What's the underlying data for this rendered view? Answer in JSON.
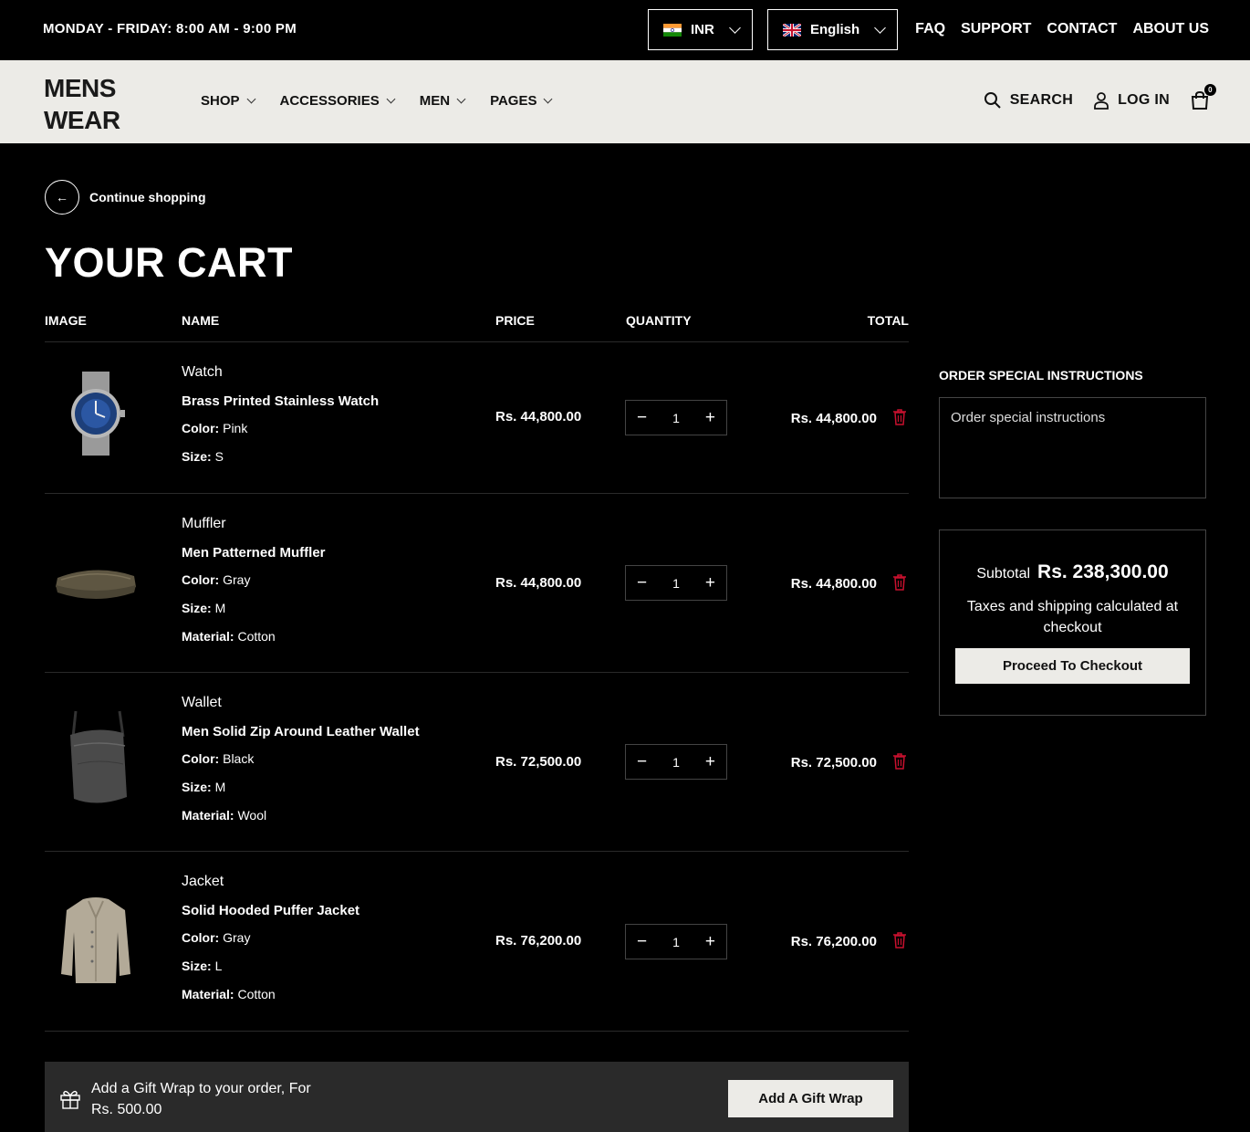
{
  "topbar": {
    "hours": "MONDAY - FRIDAY: 8:00 AM - 9:00 PM",
    "currency": "INR",
    "language": "English",
    "links": [
      "FAQ",
      "SUPPORT",
      "CONTACT",
      "ABOUT US"
    ]
  },
  "header": {
    "logo_line1": "MENS",
    "logo_line2": "WEAR",
    "nav": [
      "SHOP",
      "ACCESSORIES",
      "MEN",
      "PAGES"
    ],
    "search_label": "SEARCH",
    "login_label": "LOG IN",
    "cart_count": "0"
  },
  "cart": {
    "continue_label": "Continue shopping",
    "title": "YOUR CART",
    "columns": {
      "image": "IMAGE",
      "name": "NAME",
      "price": "PRICE",
      "quantity": "QUANTITY",
      "total": "TOTAL"
    },
    "items": [
      {
        "category": "Watch",
        "name": "Brass Printed Stainless Watch",
        "color_label": "Color:",
        "color": "Pink",
        "size_label": "Size:",
        "size": "S",
        "material_label": "",
        "material": "",
        "price": "Rs. 44,800.00",
        "qty": "1",
        "total": "Rs. 44,800.00"
      },
      {
        "category": "Muffler",
        "name": "Men Patterned Muffler",
        "color_label": "Color:",
        "color": "Gray",
        "size_label": "Size:",
        "size": "M",
        "material_label": "Material:",
        "material": "Cotton",
        "price": "Rs. 44,800.00",
        "qty": "1",
        "total": "Rs. 44,800.00"
      },
      {
        "category": "Wallet",
        "name": "Men Solid Zip Around Leather Wallet",
        "color_label": "Color:",
        "color": "Black",
        "size_label": "Size:",
        "size": "M",
        "material_label": "Material:",
        "material": "Wool",
        "price": "Rs. 72,500.00",
        "qty": "1",
        "total": "Rs. 72,500.00"
      },
      {
        "category": "Jacket",
        "name": "Solid Hooded Puffer Jacket",
        "color_label": "Color:",
        "color": "Gray",
        "size_label": "Size:",
        "size": "L",
        "material_label": "Material:",
        "material": "Cotton",
        "price": "Rs. 76,200.00",
        "qty": "1",
        "total": "Rs. 76,200.00"
      }
    ],
    "qty_minus": "−",
    "qty_plus": "+"
  },
  "sidebar": {
    "instructions_title": "ORDER SPECIAL INSTRUCTIONS",
    "instructions_placeholder": "Order special instructions",
    "subtotal_label": "Subtotal",
    "subtotal_value": "Rs. 238,300.00",
    "tax_note": "Taxes and shipping calculated at checkout",
    "checkout_label": "Proceed To Checkout"
  },
  "gift": {
    "line1": "Add a Gift Wrap to your order, For",
    "line2": "Rs. 500.00",
    "button": "Add A Gift Wrap"
  },
  "colors": {
    "accent_red": "#c8102e",
    "header_bg": "#ecebe7",
    "gift_bg": "#2a2a2a"
  }
}
